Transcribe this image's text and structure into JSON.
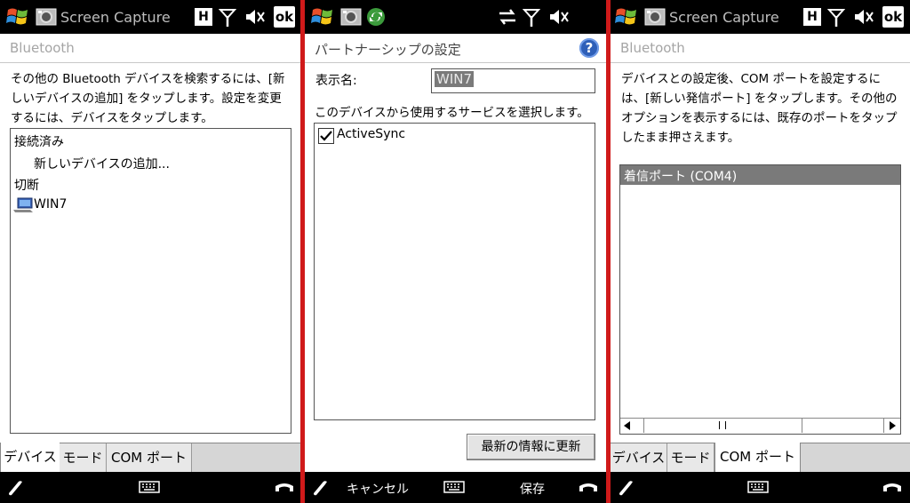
{
  "status": {
    "app_title": "Screen Capture",
    "h_indicator": "H",
    "ok_label": "ok"
  },
  "panel1": {
    "header": "Bluetooth",
    "description": "その他の Bluetooth デバイスを検索するには、[新しいデバイスの追加] をタップします。設定を変更するには、デバイスをタップします。",
    "list": {
      "connected_heading": "接続済み",
      "add_device": "新しいデバイスの追加...",
      "disconnected_heading": "切断",
      "device_name": "WIN7"
    },
    "tabs": [
      "デバイス",
      "モード",
      "COM ポート"
    ],
    "active_tab": 0
  },
  "panel2": {
    "header": "パートナーシップの設定",
    "display_name_label": "表示名:",
    "display_name_value": "WIN7",
    "services_prompt": "このデバイスから使用するサービスを選択します。",
    "services": [
      {
        "label": "ActiveSync",
        "checked": true
      }
    ],
    "refresh_button": "最新の情報に更新",
    "soft_left": "キャンセル",
    "soft_right": "保存"
  },
  "panel3": {
    "header": "Bluetooth",
    "description": "デバイスとの設定後、COM ポートを設定するには、[新しい発信ポート] をタップします。その他のオプションを表示するには、既存のポートをタップしたまま押さえます。",
    "ports": [
      "着信ポート (COM4)"
    ],
    "tabs": [
      "デバイス",
      "モード",
      "COM ポート"
    ],
    "active_tab": 2
  },
  "colors": {
    "divider": "#d01a1a",
    "selection": "#7a7a7a",
    "help_icon": "#2e5fb8"
  }
}
